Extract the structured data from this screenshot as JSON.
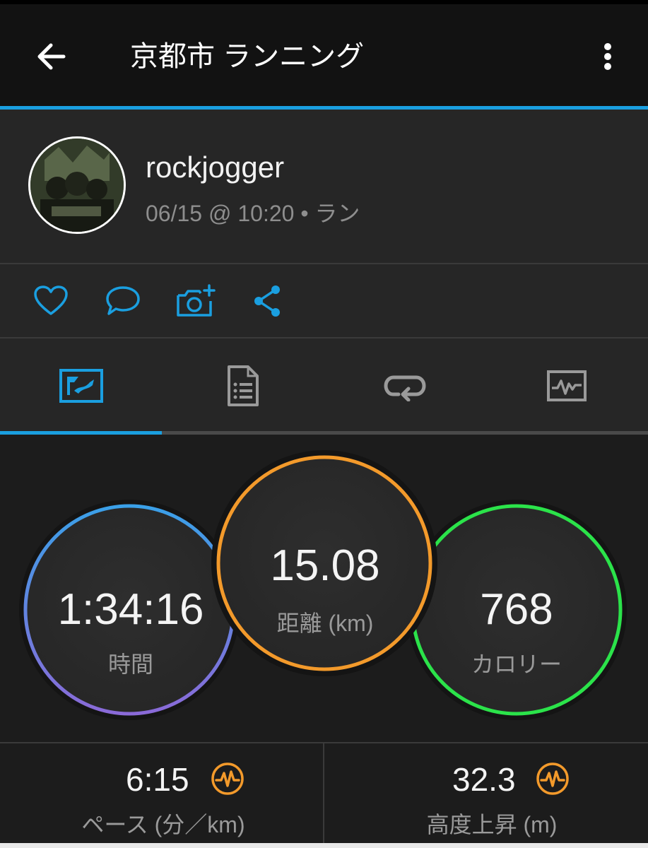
{
  "header": {
    "title": "京都市 ランニング"
  },
  "profile": {
    "username": "rockjogger",
    "meta": "06/15 @ 10:20 • ラン"
  },
  "actions": [
    "heart-icon",
    "comment-icon",
    "add-photo-icon",
    "share-icon"
  ],
  "tabs": [
    "map-tab",
    "details-tab",
    "laps-tab",
    "charts-tab"
  ],
  "stats": {
    "time": {
      "value": "1:34:16",
      "label": "時間"
    },
    "distance": {
      "value": "15.08",
      "label": "距離 (km)"
    },
    "calories": {
      "value": "768",
      "label": "カロリー"
    }
  },
  "metrics": {
    "pace": {
      "value": "6:15",
      "label": "ペース (分／km)"
    },
    "elevation": {
      "value": "32.3",
      "label": "高度上昇 (m)"
    }
  },
  "colors": {
    "accent": "#1a9fe0",
    "time_ring_start": "#3aa0e8",
    "time_ring_end": "#8a6ad8",
    "distance_ring": "#f39a2b",
    "calories_ring": "#2be34a",
    "metric_icon": "#f39a2b"
  }
}
